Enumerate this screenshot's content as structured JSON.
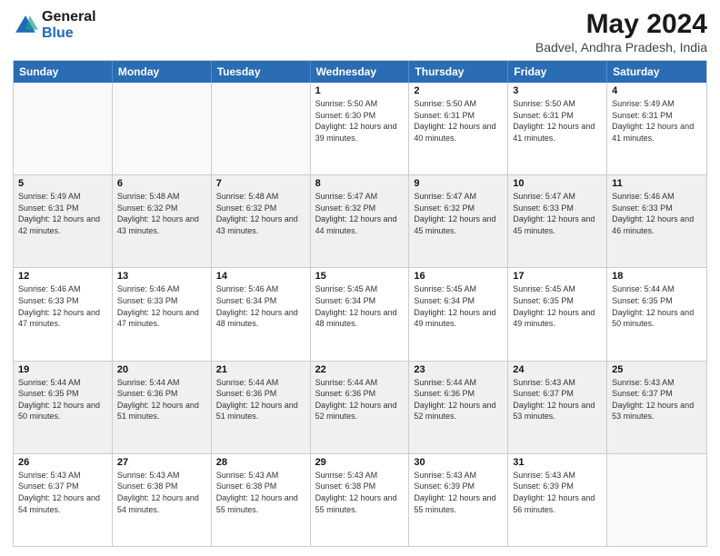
{
  "logo": {
    "general": "General",
    "blue": "Blue"
  },
  "title": "May 2024",
  "subtitle": "Badvel, Andhra Pradesh, India",
  "header_days": [
    "Sunday",
    "Monday",
    "Tuesday",
    "Wednesday",
    "Thursday",
    "Friday",
    "Saturday"
  ],
  "weeks": [
    [
      {
        "day": "",
        "info": ""
      },
      {
        "day": "",
        "info": ""
      },
      {
        "day": "",
        "info": ""
      },
      {
        "day": "1",
        "info": "Sunrise: 5:50 AM\nSunset: 6:30 PM\nDaylight: 12 hours and 39 minutes."
      },
      {
        "day": "2",
        "info": "Sunrise: 5:50 AM\nSunset: 6:31 PM\nDaylight: 12 hours and 40 minutes."
      },
      {
        "day": "3",
        "info": "Sunrise: 5:50 AM\nSunset: 6:31 PM\nDaylight: 12 hours and 41 minutes."
      },
      {
        "day": "4",
        "info": "Sunrise: 5:49 AM\nSunset: 6:31 PM\nDaylight: 12 hours and 41 minutes."
      }
    ],
    [
      {
        "day": "5",
        "info": "Sunrise: 5:49 AM\nSunset: 6:31 PM\nDaylight: 12 hours and 42 minutes."
      },
      {
        "day": "6",
        "info": "Sunrise: 5:48 AM\nSunset: 6:32 PM\nDaylight: 12 hours and 43 minutes."
      },
      {
        "day": "7",
        "info": "Sunrise: 5:48 AM\nSunset: 6:32 PM\nDaylight: 12 hours and 43 minutes."
      },
      {
        "day": "8",
        "info": "Sunrise: 5:47 AM\nSunset: 6:32 PM\nDaylight: 12 hours and 44 minutes."
      },
      {
        "day": "9",
        "info": "Sunrise: 5:47 AM\nSunset: 6:32 PM\nDaylight: 12 hours and 45 minutes."
      },
      {
        "day": "10",
        "info": "Sunrise: 5:47 AM\nSunset: 6:33 PM\nDaylight: 12 hours and 45 minutes."
      },
      {
        "day": "11",
        "info": "Sunrise: 5:46 AM\nSunset: 6:33 PM\nDaylight: 12 hours and 46 minutes."
      }
    ],
    [
      {
        "day": "12",
        "info": "Sunrise: 5:46 AM\nSunset: 6:33 PM\nDaylight: 12 hours and 47 minutes."
      },
      {
        "day": "13",
        "info": "Sunrise: 5:46 AM\nSunset: 6:33 PM\nDaylight: 12 hours and 47 minutes."
      },
      {
        "day": "14",
        "info": "Sunrise: 5:46 AM\nSunset: 6:34 PM\nDaylight: 12 hours and 48 minutes."
      },
      {
        "day": "15",
        "info": "Sunrise: 5:45 AM\nSunset: 6:34 PM\nDaylight: 12 hours and 48 minutes."
      },
      {
        "day": "16",
        "info": "Sunrise: 5:45 AM\nSunset: 6:34 PM\nDaylight: 12 hours and 49 minutes."
      },
      {
        "day": "17",
        "info": "Sunrise: 5:45 AM\nSunset: 6:35 PM\nDaylight: 12 hours and 49 minutes."
      },
      {
        "day": "18",
        "info": "Sunrise: 5:44 AM\nSunset: 6:35 PM\nDaylight: 12 hours and 50 minutes."
      }
    ],
    [
      {
        "day": "19",
        "info": "Sunrise: 5:44 AM\nSunset: 6:35 PM\nDaylight: 12 hours and 50 minutes."
      },
      {
        "day": "20",
        "info": "Sunrise: 5:44 AM\nSunset: 6:36 PM\nDaylight: 12 hours and 51 minutes."
      },
      {
        "day": "21",
        "info": "Sunrise: 5:44 AM\nSunset: 6:36 PM\nDaylight: 12 hours and 51 minutes."
      },
      {
        "day": "22",
        "info": "Sunrise: 5:44 AM\nSunset: 6:36 PM\nDaylight: 12 hours and 52 minutes."
      },
      {
        "day": "23",
        "info": "Sunrise: 5:44 AM\nSunset: 6:36 PM\nDaylight: 12 hours and 52 minutes."
      },
      {
        "day": "24",
        "info": "Sunrise: 5:43 AM\nSunset: 6:37 PM\nDaylight: 12 hours and 53 minutes."
      },
      {
        "day": "25",
        "info": "Sunrise: 5:43 AM\nSunset: 6:37 PM\nDaylight: 12 hours and 53 minutes."
      }
    ],
    [
      {
        "day": "26",
        "info": "Sunrise: 5:43 AM\nSunset: 6:37 PM\nDaylight: 12 hours and 54 minutes."
      },
      {
        "day": "27",
        "info": "Sunrise: 5:43 AM\nSunset: 6:38 PM\nDaylight: 12 hours and 54 minutes."
      },
      {
        "day": "28",
        "info": "Sunrise: 5:43 AM\nSunset: 6:38 PM\nDaylight: 12 hours and 55 minutes."
      },
      {
        "day": "29",
        "info": "Sunrise: 5:43 AM\nSunset: 6:38 PM\nDaylight: 12 hours and 55 minutes."
      },
      {
        "day": "30",
        "info": "Sunrise: 5:43 AM\nSunset: 6:39 PM\nDaylight: 12 hours and 55 minutes."
      },
      {
        "day": "31",
        "info": "Sunrise: 5:43 AM\nSunset: 6:39 PM\nDaylight: 12 hours and 56 minutes."
      },
      {
        "day": "",
        "info": ""
      }
    ]
  ]
}
